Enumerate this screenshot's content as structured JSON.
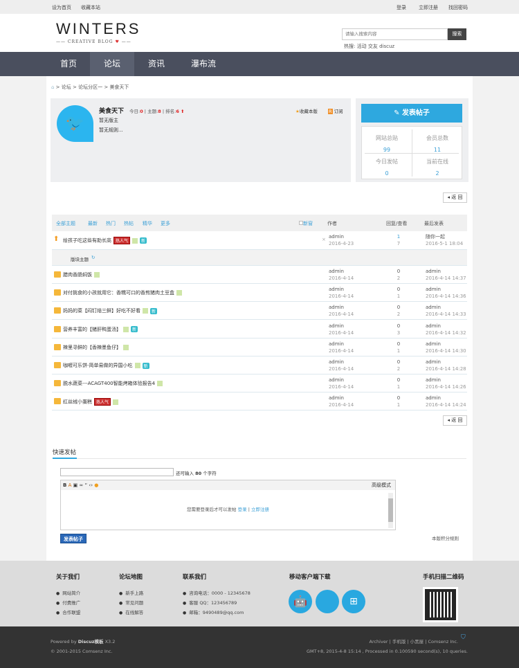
{
  "topbar": {
    "left": [
      "设为首页",
      "收藏本站"
    ],
    "right": [
      "登录",
      "立即注册",
      "找回密码"
    ]
  },
  "header": {
    "logo": "WINTERS",
    "logo_sub": "CREATIVE BLOG",
    "search_placeholder": "请输入搜索内容",
    "search_button": "搜索",
    "hot_label": "热搜:",
    "hot": [
      "活动",
      "交友",
      "discuz"
    ]
  },
  "nav": [
    "首页",
    "论坛",
    "资讯",
    "瀑布流"
  ],
  "breadcrumb": [
    "论坛",
    "论坛分区一",
    "美食天下"
  ],
  "forum": {
    "name": "美食天下",
    "today_label": "今日:",
    "today": "0",
    "topics_label": "主题:",
    "topics": "8",
    "rank_label": "排名:",
    "rank": "6",
    "moderator": "暂无版主",
    "rules": "暂无规则...",
    "favorite": "收藏本版",
    "subscribe": "订阅"
  },
  "sidebar": {
    "post_button": "发表帖子",
    "stats": [
      {
        "label": "网站总贴",
        "value": "99"
      },
      {
        "label": "会员总数",
        "value": "11"
      },
      {
        "label": "今日发帖",
        "value": "0"
      },
      {
        "label": "当前在线",
        "value": "2"
      }
    ]
  },
  "back_label": "返 回",
  "list": {
    "filters": [
      "全部主题",
      "最新",
      "热门",
      "热帖",
      "精华",
      "更多"
    ],
    "new_window": "新窗",
    "col_author": "作者",
    "col_replies": "回复/查看",
    "col_last": "最后发表",
    "section_label": "版块主题",
    "pinned": {
      "title": "给孩子吃这些有助长高",
      "badges": [
        "hot",
        "img",
        "new"
      ],
      "author": "admin",
      "date": "2016-4-23",
      "replies": "1",
      "views": "7",
      "last_user": "随你一起",
      "last_time": "2016-5-1 18:04"
    },
    "rows": [
      {
        "title": "腊肉香肠焖饭",
        "badges": [
          "img"
        ],
        "author": "admin",
        "date": "2016-4-14",
        "replies": "0",
        "views": "2",
        "last_user": "admin",
        "last_time": "2016-4-14 14:37"
      },
      {
        "title": "对付挑食的小孩就用它：香糯可口的香煎猪肉土豆盒",
        "badges": [
          "img"
        ],
        "author": "admin",
        "date": "2016-4-14",
        "replies": "0",
        "views": "1",
        "last_user": "admin",
        "last_time": "2016-4-14 14:36"
      },
      {
        "title": "妈妈的菜【闷钉焙三鲜】好吃不好看",
        "badges": [
          "img",
          "new"
        ],
        "author": "admin",
        "date": "2016-4-14",
        "replies": "0",
        "views": "2",
        "last_user": "admin",
        "last_time": "2016-4-14 14:33"
      },
      {
        "title": "营养丰富的【猪肝鸭蛋汤】",
        "badges": [
          "img",
          "new"
        ],
        "author": "admin",
        "date": "2016-4-14",
        "replies": "0",
        "views": "3",
        "last_user": "admin",
        "last_time": "2016-4-14 14:32"
      },
      {
        "title": "辣里寻鲜的【香辣墨鱼仔】",
        "badges": [
          "img"
        ],
        "author": "admin",
        "date": "2016-4-14",
        "replies": "0",
        "views": "1",
        "last_user": "admin",
        "last_time": "2016-4-14 14:30"
      },
      {
        "title": "咖喱可乐饼-简单易做的异国小吃",
        "badges": [
          "img",
          "new"
        ],
        "author": "admin",
        "date": "2016-4-14",
        "replies": "0",
        "views": "2",
        "last_user": "admin",
        "last_time": "2016-4-14 14:28"
      },
      {
        "title": "脱水蔬菜---ACAGT400智能烤箱体验报告4",
        "badges": [
          "img"
        ],
        "author": "admin",
        "date": "2016-4-14",
        "replies": "0",
        "views": "1",
        "last_user": "admin",
        "last_time": "2016-4-14 14:26"
      },
      {
        "title": "红丝绒小蛋糕",
        "badges": [
          "hot",
          "img"
        ],
        "author": "admin",
        "date": "2016-4-14",
        "replies": "0",
        "views": "1",
        "last_user": "admin",
        "last_time": "2016-4-14 14:24"
      }
    ],
    "badge_hot": "热人气",
    "badge_new": "新"
  },
  "quickpost": {
    "title": "快速发帖",
    "remain_pre": "还可输入",
    "remain": "80",
    "remain_post": "个字符",
    "advanced": "高级模式",
    "login_msg": "您需要登录后才可以发帖",
    "login": "登录",
    "register": "立即注册",
    "submit": "发表帖子",
    "credit_rules": "本版积分规则"
  },
  "footer": {
    "about": {
      "title": "关于我们",
      "items": [
        "网站简介",
        "付费推广",
        "合作联盟"
      ]
    },
    "map": {
      "title": "论坛地图",
      "items": [
        "新手上路",
        "常见问题",
        "在线解答"
      ]
    },
    "contact": {
      "title": "联系我们",
      "items": [
        "咨询电话：0000 - 12345678",
        "客服 QQ：123456789",
        "邮箱：9490489@qq.com"
      ]
    },
    "mobile": {
      "title": "移动客户端下载"
    },
    "qr": {
      "title": "手机扫描二维码"
    },
    "powered_pre": "Powered by",
    "powered_brand": "Discuz模板",
    "powered_ver": "X3.2",
    "copyright": "© 2001-2015 Comsenz Inc.",
    "links": [
      "Archiver",
      "手机版",
      "小黑屋",
      "Comsenz Inc."
    ],
    "stats": "GMT+8, 2015-4-8 15:14 , Processed in 0.100590 second(s), 10 queries."
  }
}
